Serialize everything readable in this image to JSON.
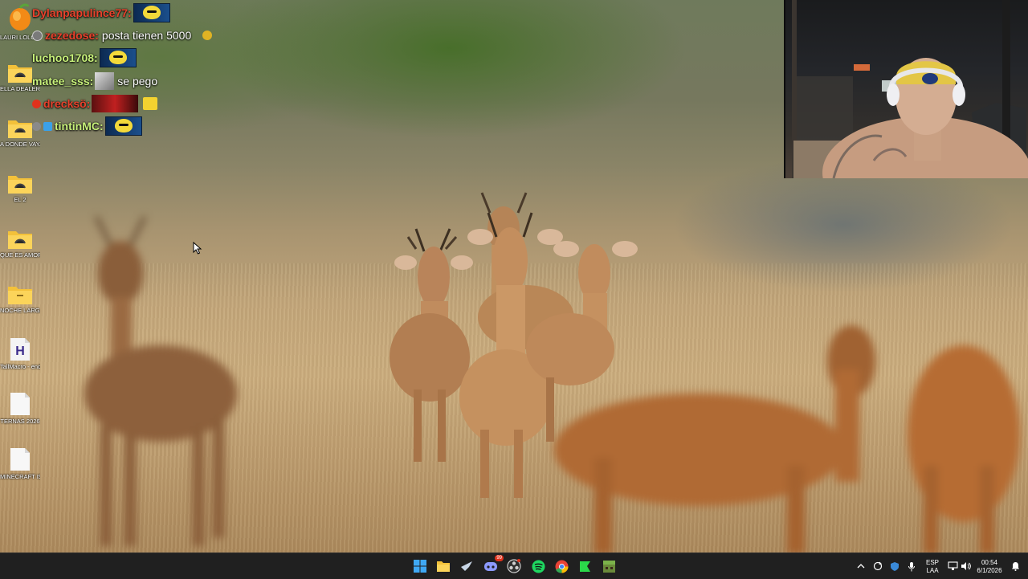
{
  "desktop": {
    "icons": [
      {
        "name": "lauri-lolo-folder",
        "label": "LAURI LOLO 2",
        "kind": "folder-fl"
      },
      {
        "name": "ella-dealer-folder",
        "label": "ELLA DEALER YO NORMAL",
        "kind": "folder"
      },
      {
        "name": "a-donde-vaya-voy-folder",
        "label": "A DONDE VAYA VOY",
        "kind": "folder"
      },
      {
        "name": "el-2-folder",
        "label": "EL 2",
        "kind": "folder"
      },
      {
        "name": "que-es-amor-folder",
        "label": "QUE ES AMOR",
        "kind": "folder"
      },
      {
        "name": "noche-larga-folder",
        "label": "NOCHE LARGA",
        "kind": "folder-plain"
      },
      {
        "name": "taillmacro-file",
        "label": "TallMacro - end-1",
        "kind": "h-file"
      },
      {
        "name": "ternas-2026-file",
        "label": "TERNAS 2026",
        "kind": "doc"
      },
      {
        "name": "minecraft-isla-file",
        "label": "MINECRAFT ISLA DE EP...",
        "kind": "doc"
      }
    ]
  },
  "chat": {
    "messages": [
      {
        "user": "Dylanpapulince77:",
        "color": "#e8412c",
        "message": "",
        "emote": true
      },
      {
        "user": "zezedose:",
        "color": "#e8412c",
        "message": "posta tienen 5000",
        "emote": false,
        "trailing_icon": true
      },
      {
        "user": "luchoo1708:",
        "color": "#c7f07a",
        "message": "",
        "emote": true
      },
      {
        "user": "matee_sss:",
        "color": "#c7f07a",
        "message": "se pego",
        "emote": false,
        "photo_emote": true
      },
      {
        "user": "drecksö:",
        "color": "#e8412c",
        "message": "",
        "emote": false,
        "red_emote": true
      },
      {
        "user": "tintinMC:",
        "color": "#c7f07a",
        "message": "",
        "emote": true
      }
    ]
  },
  "taskbar": {
    "apps": [
      "windows-start-icon",
      "file-explorer-icon",
      "steam-icon",
      "discord-icon",
      "obs-icon",
      "spotify-icon",
      "chrome-icon",
      "fl-studio-icon",
      "minecraft-icon"
    ],
    "discord_badge": "99",
    "language": "ESP",
    "layout": "LAA",
    "time": "00:54",
    "date": "6/1/2026"
  }
}
